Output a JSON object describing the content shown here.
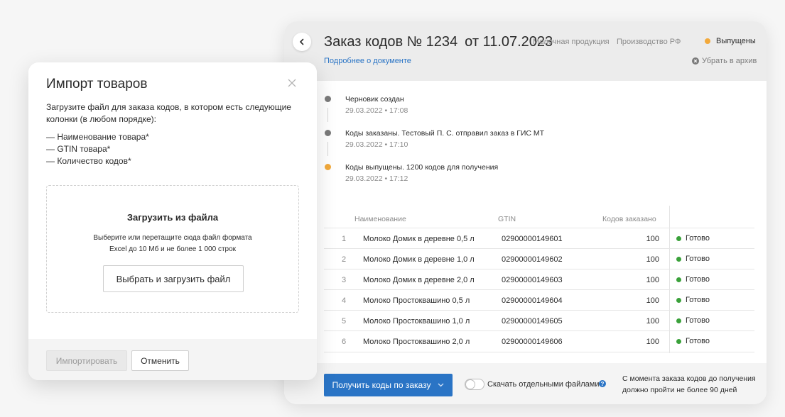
{
  "colors": {
    "accent": "#2a74c5",
    "status_released": "#f2a93b",
    "status_done": "#3aa13a",
    "timeline_gray": "#7a7a7a"
  },
  "order": {
    "title": "Заказ кодов № 1234",
    "date": "от 11.07.2023",
    "category": "Молочная продукция",
    "origin": "Производство РФ",
    "status": "Выпущены",
    "details_link": "Подробнее о документе",
    "archive_label": "Убрать в архив",
    "timeline": [
      {
        "text": "Черновик создан",
        "time": "29.03.2022 • 17:08"
      },
      {
        "text": "Коды заказаны. Тестовый П. С. отправил заказ в ГИС МТ",
        "time": "29.03.2022 • 17:10"
      },
      {
        "text": "Коды выпущены. 1200 кодов для получения",
        "time": "29.03.2022 • 17:12"
      }
    ],
    "table": {
      "headers": {
        "name": "Наименование",
        "gtin": "GTIN",
        "qty": "Кодов заказано"
      },
      "rows": [
        {
          "n": "1",
          "name": "Молоко Домик в деревне 0,5 л",
          "gtin": "02900000149601",
          "qty": "100",
          "status": "Готово"
        },
        {
          "n": "2",
          "name": "Молоко Домик в деревне 1,0 л",
          "gtin": "02900000149602",
          "qty": "100",
          "status": "Готово"
        },
        {
          "n": "3",
          "name": "Молоко Домик в деревне 2,0 л",
          "gtin": "02900000149603",
          "qty": "100",
          "status": "Готово"
        },
        {
          "n": "4",
          "name": "Молоко Простоквашино 0,5 л",
          "gtin": "02900000149604",
          "qty": "100",
          "status": "Готово"
        },
        {
          "n": "5",
          "name": "Молоко Простоквашино 1,0 л",
          "gtin": "02900000149605",
          "qty": "100",
          "status": "Готово"
        },
        {
          "n": "6",
          "name": "Молоко Простоквашино 2,0 л",
          "gtin": "02900000149606",
          "qty": "100",
          "status": "Готово"
        }
      ]
    },
    "footer": {
      "get_codes_label": "Получить коды по заказу",
      "toggle_label": "Скачать отдельными файлами",
      "toggle_on": false,
      "note_line1": "С момента заказа кодов до получения",
      "note_line2": "должно пройти не более 90 дней"
    }
  },
  "import_modal": {
    "title": "Импорт товаров",
    "description": "Загрузите файл для заказа кодов, в котором есть следующие колонки (в любом порядке):",
    "columns": [
      "— Наименование товара*",
      "— GTIN товара*",
      "— Количество кодов*"
    ],
    "drop_title": "Загрузить из файла",
    "drop_hint_line1": "Выберите или перетащите сюда файл формата",
    "drop_hint_line2": "Excel до 10 Мб и не более 1 000 строк",
    "choose_button": "Выбрать и загрузить файл",
    "import_button": "Импортировать",
    "cancel_button": "Отменить"
  }
}
